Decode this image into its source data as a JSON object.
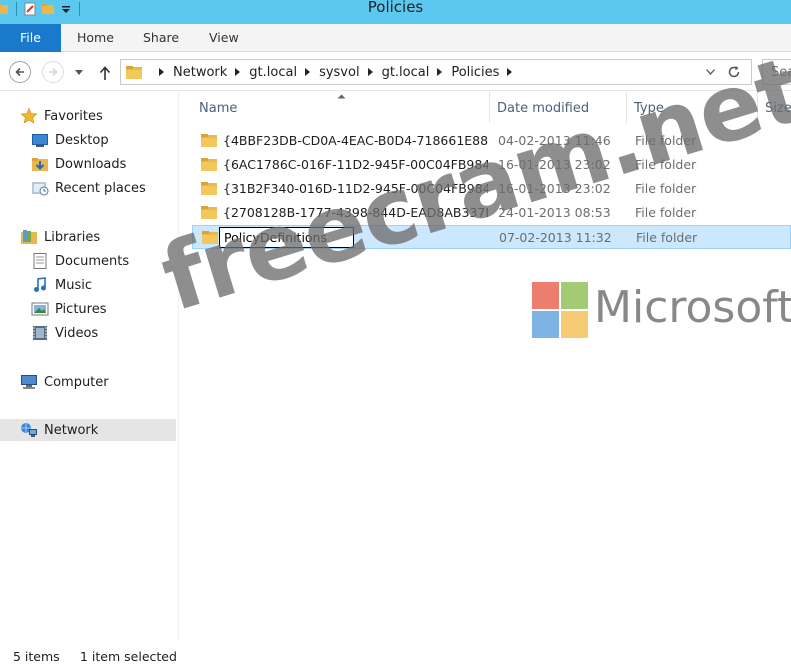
{
  "window": {
    "title": "Policies"
  },
  "ribbon": {
    "tabs": [
      {
        "label": "File"
      },
      {
        "label": "Home"
      },
      {
        "label": "Share"
      },
      {
        "label": "View"
      }
    ],
    "accent": "#1979ca",
    "titlebar_color": "#5cc8f0"
  },
  "address": {
    "crumbs": [
      "Network",
      "gt.local",
      "sysvol",
      "gt.local",
      "Policies"
    ]
  },
  "search": {
    "placeholder": "Sea"
  },
  "navpane": {
    "favorites": {
      "label": "Favorites",
      "icon": "star-icon"
    },
    "favorite_items": [
      {
        "label": "Desktop",
        "icon": "desktop-icon"
      },
      {
        "label": "Downloads",
        "icon": "downloads-icon"
      },
      {
        "label": "Recent places",
        "icon": "recent-places-icon"
      }
    ],
    "libraries": {
      "label": "Libraries",
      "icon": "libraries-icon"
    },
    "library_items": [
      {
        "label": "Documents",
        "icon": "documents-icon"
      },
      {
        "label": "Music",
        "icon": "music-icon"
      },
      {
        "label": "Pictures",
        "icon": "pictures-icon"
      },
      {
        "label": "Videos",
        "icon": "videos-icon"
      }
    ],
    "computer": {
      "label": "Computer",
      "icon": "computer-icon"
    },
    "network": {
      "label": "Network",
      "icon": "network-icon",
      "selected": true
    }
  },
  "columns": {
    "name": "Name",
    "date": "Date modified",
    "type": "Type",
    "size": "Size"
  },
  "files": [
    {
      "name": "{4BBF23DB-CD0A-4EAC-B0D4-718661E88...",
      "date": "04-02-2013 11:46",
      "type": "File folder"
    },
    {
      "name": "{6AC1786C-016F-11D2-945F-00C04FB984...",
      "date": "16-01-2013 23:02",
      "type": "File folder"
    },
    {
      "name": "{31B2F340-016D-11D2-945F-00C04FB984...",
      "date": "16-01-2013 23:02",
      "type": "File folder"
    },
    {
      "name": "{2708128B-1777-4398-844D-EAD8AB337D...",
      "date": "24-01-2013 08:53",
      "type": "File folder"
    },
    {
      "name": "PolicyDefinitions",
      "date": "07-02-2013 11:32",
      "type": "File folder",
      "selected": true,
      "renaming": true
    }
  ],
  "watermark": {
    "site": "freecram.net",
    "brand": "Microsoft"
  },
  "status": {
    "count": "5 items",
    "selection": "1 item selected"
  }
}
